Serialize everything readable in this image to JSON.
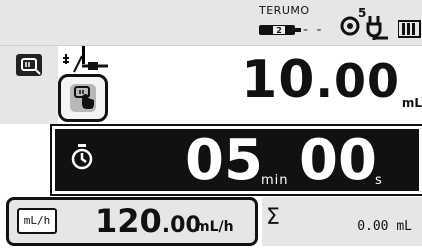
{
  "status": {
    "brand": "TERUMO",
    "syringe_size": "2",
    "dash": "- -",
    "sensor_level": "5",
    "icons": [
      "syringe-indicator-icon",
      "pressure-sensor-icon",
      "ac-plug-icon",
      "battery-icon"
    ]
  },
  "mode_icons": [
    "mode-select-icon",
    "syringe-fit-icon",
    "hand-touch-icon"
  ],
  "volume": {
    "integer": "10",
    "decimal": ".00",
    "unit": "mL"
  },
  "timer": {
    "icon": "stopwatch-icon",
    "minutes": "05",
    "minutes_unit": "min",
    "seconds": "00",
    "seconds_unit": "s"
  },
  "rate": {
    "button_label": "mL/h",
    "integer": "120",
    "decimal": ".00",
    "unit": "mL/h"
  },
  "total": {
    "symbol": "Σ",
    "value": "0.00 mL"
  },
  "colors": {
    "panel_gray": "#e6e6e6",
    "timer_bg": "#111111",
    "text": "#111111"
  }
}
